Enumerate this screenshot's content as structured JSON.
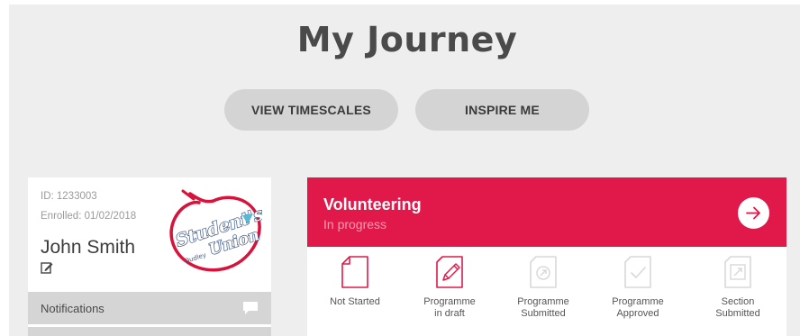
{
  "header": {
    "title": "My Journey"
  },
  "buttons": {
    "timescales": "VIEW TIMESCALES",
    "inspire": "INSPIRE ME"
  },
  "profile": {
    "id": "ID: 1233003",
    "enrolled": "Enrolled: 01/02/2018",
    "name": "John Smith",
    "logo_alt": "Students' Union Dudley",
    "notifications_label": "Notifications"
  },
  "programme": {
    "title": "Volunteering",
    "status": "In progress",
    "accent_color": "#e0194a",
    "steps": [
      {
        "label": "Not Started",
        "icon": "blank-page-icon",
        "active": true
      },
      {
        "label": "Programme\nin draft",
        "icon": "pencil-page-icon",
        "active": true
      },
      {
        "label": "Programme\nSubmitted",
        "icon": "submitted-page-icon",
        "active": false
      },
      {
        "label": "Programme\nApproved",
        "icon": "check-page-icon",
        "active": false
      },
      {
        "label": "Section\nSubmitted",
        "icon": "section-page-icon",
        "active": false
      }
    ]
  }
}
